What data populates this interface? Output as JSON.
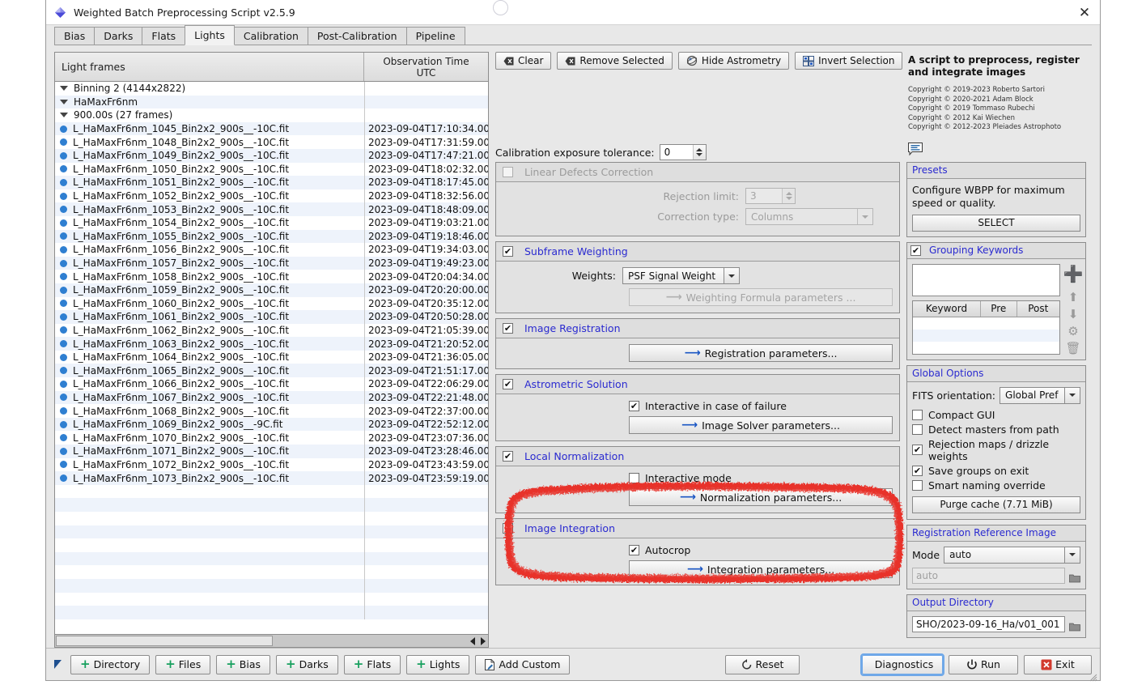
{
  "window": {
    "title": "Weighted Batch Preprocessing Script v2.5.9",
    "close_label": "✕",
    "app_icon": "diamond-icon"
  },
  "tabs": [
    {
      "label": "Bias",
      "active": false
    },
    {
      "label": "Darks",
      "active": false
    },
    {
      "label": "Flats",
      "active": false
    },
    {
      "label": "Lights",
      "active": true
    },
    {
      "label": "Calibration",
      "active": false
    },
    {
      "label": "Post-Calibration",
      "active": false
    },
    {
      "label": "Pipeline",
      "active": false
    }
  ],
  "file_table": {
    "col_name": "Light frames",
    "col_time_line1": "Observation Time",
    "col_time_line2": "UTC",
    "tree": [
      {
        "type": "group",
        "indent": 1,
        "label": "Binning 2 (4144x2822)",
        "time": ""
      },
      {
        "type": "group",
        "indent": 2,
        "label": "HaMaxFr6nm",
        "time": ""
      },
      {
        "type": "group",
        "indent": 3,
        "label": "900.00s (27 frames)",
        "time": ""
      },
      {
        "type": "file",
        "indent": 4,
        "label": "L_HaMaxFr6nm_1045_Bin2x2_900s__-10C.fit",
        "time": "2023-09-04T17:10:34.000"
      },
      {
        "type": "file",
        "indent": 4,
        "label": "L_HaMaxFr6nm_1048_Bin2x2_900s__-10C.fit",
        "time": "2023-09-04T17:31:59.000"
      },
      {
        "type": "file",
        "indent": 4,
        "label": "L_HaMaxFr6nm_1049_Bin2x2_900s__-10C.fit",
        "time": "2023-09-04T17:47:21.000"
      },
      {
        "type": "file",
        "indent": 4,
        "label": "L_HaMaxFr6nm_1050_Bin2x2_900s__-10C.fit",
        "time": "2023-09-04T18:02:32.000"
      },
      {
        "type": "file",
        "indent": 4,
        "label": "L_HaMaxFr6nm_1051_Bin2x2_900s__-10C.fit",
        "time": "2023-09-04T18:17:45.000"
      },
      {
        "type": "file",
        "indent": 4,
        "label": "L_HaMaxFr6nm_1052_Bin2x2_900s__-10C.fit",
        "time": "2023-09-04T18:32:56.000"
      },
      {
        "type": "file",
        "indent": 4,
        "label": "L_HaMaxFr6nm_1053_Bin2x2_900s__-10C.fit",
        "time": "2023-09-04T18:48:09.000"
      },
      {
        "type": "file",
        "indent": 4,
        "label": "L_HaMaxFr6nm_1054_Bin2x2_900s__-10C.fit",
        "time": "2023-09-04T19:03:21.000"
      },
      {
        "type": "file",
        "indent": 4,
        "label": "L_HaMaxFr6nm_1055_Bin2x2_900s__-10C.fit",
        "time": "2023-09-04T19:18:46.000"
      },
      {
        "type": "file",
        "indent": 4,
        "label": "L_HaMaxFr6nm_1056_Bin2x2_900s__-10C.fit",
        "time": "2023-09-04T19:34:03.000"
      },
      {
        "type": "file",
        "indent": 4,
        "label": "L_HaMaxFr6nm_1057_Bin2x2_900s__-10C.fit",
        "time": "2023-09-04T19:49:23.000"
      },
      {
        "type": "file",
        "indent": 4,
        "label": "L_HaMaxFr6nm_1058_Bin2x2_900s__-10C.fit",
        "time": "2023-09-04T20:04:34.000"
      },
      {
        "type": "file",
        "indent": 4,
        "label": "L_HaMaxFr6nm_1059_Bin2x2_900s__-10C.fit",
        "time": "2023-09-04T20:20:00.000"
      },
      {
        "type": "file",
        "indent": 4,
        "label": "L_HaMaxFr6nm_1060_Bin2x2_900s__-10C.fit",
        "time": "2023-09-04T20:35:12.000"
      },
      {
        "type": "file",
        "indent": 4,
        "label": "L_HaMaxFr6nm_1061_Bin2x2_900s__-10C.fit",
        "time": "2023-09-04T20:50:28.000"
      },
      {
        "type": "file",
        "indent": 4,
        "label": "L_HaMaxFr6nm_1062_Bin2x2_900s__-10C.fit",
        "time": "2023-09-04T21:05:39.000"
      },
      {
        "type": "file",
        "indent": 4,
        "label": "L_HaMaxFr6nm_1063_Bin2x2_900s__-10C.fit",
        "time": "2023-09-04T21:20:52.000"
      },
      {
        "type": "file",
        "indent": 4,
        "label": "L_HaMaxFr6nm_1064_Bin2x2_900s__-10C.fit",
        "time": "2023-09-04T21:36:05.000"
      },
      {
        "type": "file",
        "indent": 4,
        "label": "L_HaMaxFr6nm_1065_Bin2x2_900s__-10C.fit",
        "time": "2023-09-04T21:51:17.000"
      },
      {
        "type": "file",
        "indent": 4,
        "label": "L_HaMaxFr6nm_1066_Bin2x2_900s__-10C.fit",
        "time": "2023-09-04T22:06:29.000"
      },
      {
        "type": "file",
        "indent": 4,
        "label": "L_HaMaxFr6nm_1067_Bin2x2_900s__-10C.fit",
        "time": "2023-09-04T22:21:48.000"
      },
      {
        "type": "file",
        "indent": 4,
        "label": "L_HaMaxFr6nm_1068_Bin2x2_900s__-10C.fit",
        "time": "2023-09-04T22:37:00.000"
      },
      {
        "type": "file",
        "indent": 4,
        "label": "L_HaMaxFr6nm_1069_Bin2x2_900s__-9C.fit",
        "time": "2023-09-04T22:52:12.000"
      },
      {
        "type": "file",
        "indent": 4,
        "label": "L_HaMaxFr6nm_1070_Bin2x2_900s__-10C.fit",
        "time": "2023-09-04T23:07:36.000"
      },
      {
        "type": "file",
        "indent": 4,
        "label": "L_HaMaxFr6nm_1071_Bin2x2_900s__-10C.fit",
        "time": "2023-09-04T23:28:46.000"
      },
      {
        "type": "file",
        "indent": 4,
        "label": "L_HaMaxFr6nm_1072_Bin2x2_900s__-10C.fit",
        "time": "2023-09-04T23:43:59.000"
      },
      {
        "type": "file",
        "indent": 4,
        "label": "L_HaMaxFr6nm_1073_Bin2x2_900s__-10C.fit",
        "time": "2023-09-04T23:59:19.000"
      }
    ]
  },
  "toolbar": {
    "clear": "Clear",
    "remove_selected": "Remove Selected",
    "hide_astrometry": "Hide Astrometry",
    "invert_selection": "Invert Selection"
  },
  "center": {
    "calibration_tolerance_label": "Calibration exposure tolerance:",
    "calibration_tolerance_value": "0",
    "linear_defects": {
      "title": "Linear Defects Correction",
      "checked": false,
      "enabled": false,
      "rejection_limit_label": "Rejection limit:",
      "rejection_limit_value": "3",
      "correction_type_label": "Correction type:",
      "correction_type_value": "Columns"
    },
    "subframe_weighting": {
      "title": "Subframe Weighting",
      "checked": true,
      "weights_label": "Weights:",
      "weights_value": "PSF Signal Weight",
      "formula_button": "Weighting Formula parameters ...",
      "formula_enabled": false
    },
    "image_registration": {
      "title": "Image Registration",
      "checked": true,
      "params_button": "Registration parameters..."
    },
    "astrometric_solution": {
      "title": "Astrometric Solution",
      "checked": true,
      "interactive_label": "Interactive in case of failure",
      "interactive_checked": true,
      "params_button": "Image Solver parameters..."
    },
    "local_normalization": {
      "title": "Local Normalization",
      "checked": true,
      "interactive_label": "Interactive mode",
      "interactive_checked": false,
      "params_button": "Normalization parameters..."
    },
    "image_integration": {
      "title": "Image Integration",
      "checked": true,
      "autocrop_label": "Autocrop",
      "autocrop_checked": true,
      "params_button": "Integration parameters..."
    }
  },
  "sidebar": {
    "headline": "A script to preprocess, register and integrate images",
    "copyrights": [
      "Copyright © 2019-2023 Roberto Sartori",
      "Copyright © 2020-2021 Adam Block",
      "Copyright © 2019 Tommaso Rubechi",
      "Copyright © 2012 Kai Wiechen",
      "Copyright © 2012-2023 Pleiades Astrophoto"
    ],
    "presets": {
      "title": "Presets",
      "description": "Configure WBPP for maximum speed or quality.",
      "select_button": "SELECT"
    },
    "grouping_keywords": {
      "title": "Grouping Keywords",
      "checked": true,
      "input_value": "",
      "columns": [
        "Keyword",
        "Pre",
        "Post"
      ],
      "rows": []
    },
    "global_options": {
      "title": "Global Options",
      "fits_orientation_label": "FITS orientation:",
      "fits_orientation_value": "Global Pref",
      "options": [
        {
          "label": "Compact GUI",
          "checked": false
        },
        {
          "label": "Detect masters from path",
          "checked": false
        },
        {
          "label": "Rejection maps / drizzle weights",
          "checked": true
        },
        {
          "label": "Save groups on exit",
          "checked": true
        },
        {
          "label": "Smart naming override",
          "checked": false
        }
      ],
      "purge_cache_button": "Purge cache (7.71 MiB)"
    },
    "registration_reference": {
      "title": "Registration Reference Image",
      "mode_label": "Mode",
      "mode_value": "auto",
      "path_placeholder": "auto"
    },
    "output_directory": {
      "title": "Output Directory",
      "value": "SHO/2023-09-16_Ha/v01_001"
    }
  },
  "bottombar": {
    "left": [
      {
        "label": "Directory",
        "icon": "plus-icon"
      },
      {
        "label": "Files",
        "icon": "plus-icon"
      },
      {
        "label": "Bias",
        "icon": "plus-icon"
      },
      {
        "label": "Darks",
        "icon": "plus-icon"
      },
      {
        "label": "Flats",
        "icon": "plus-icon"
      },
      {
        "label": "Lights",
        "icon": "plus-icon"
      },
      {
        "label": "Add Custom",
        "icon": "document-pencil-icon"
      }
    ],
    "reset": "Reset",
    "diagnostics": "Diagnostics",
    "run": "Run",
    "exit": "Exit"
  },
  "colors": {
    "group_title": "#2a2ad0",
    "annotation": "#e8302a",
    "accent_blue": "#2f7fd1",
    "green": "#17a05e"
  }
}
